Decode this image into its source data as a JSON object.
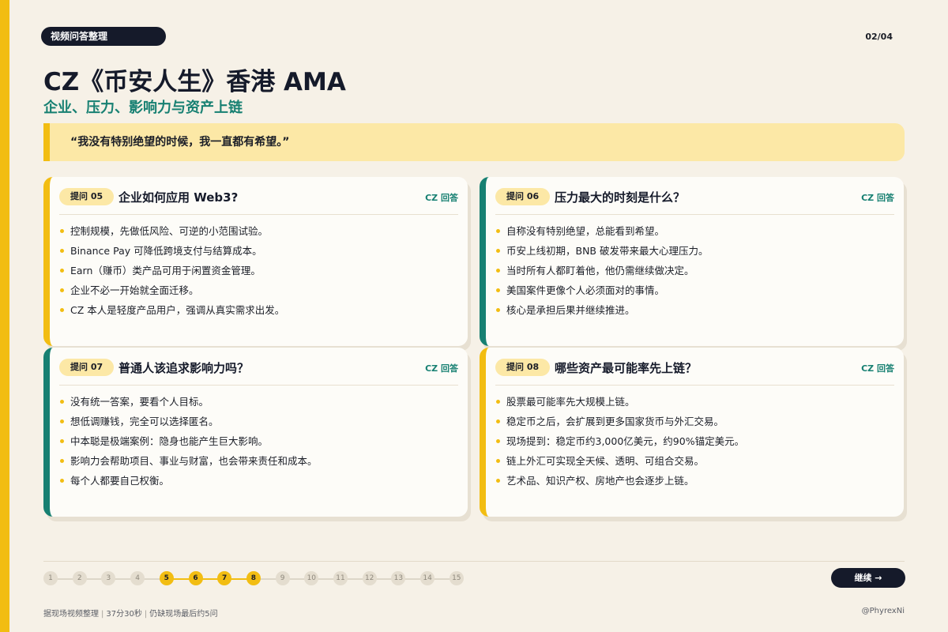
{
  "header": {
    "tag": "视频问答整理",
    "page": "02/04",
    "title": "CZ《币安人生》香港 AMA",
    "subtitle": "企业、压力、影响力与资产上链"
  },
  "quote": "“我没有特别绝望的时候，我一直都有希望。”",
  "cards": [
    {
      "tag": "提问 05",
      "title": "企业如何应用 Web3?",
      "answer_by": "CZ 回答",
      "bullets": [
        "控制规模，先做低风险、可逆的小范围试验。",
        "Binance Pay 可降低跨境支付与结算成本。",
        "Earn（赚币）类产品可用于闲置资金管理。",
        "企业不必一开始就全面迁移。",
        "CZ 本人是轻度产品用户，强调从真实需求出发。"
      ]
    },
    {
      "tag": "提问 06",
      "title": "压力最大的时刻是什么？",
      "answer_by": "CZ 回答",
      "bullets": [
        "自称没有特别绝望，总能看到希望。",
        "币安上线初期，BNB 破发带来最大心理压力。",
        "当时所有人都盯着他，他仍需继续做决定。",
        "美国案件更像个人必须面对的事情。",
        "核心是承担后果并继续推进。"
      ]
    },
    {
      "tag": "提问 07",
      "title": "普通人该追求影响力吗？",
      "answer_by": "CZ 回答",
      "bullets": [
        "没有统一答案，要看个人目标。",
        "想低调赚钱，完全可以选择匿名。",
        "中本聪是极端案例：隐身也能产生巨大影响。",
        "影响力会帮助项目、事业与财富，也会带来责任和成本。",
        "每个人都要自己权衡。"
      ]
    },
    {
      "tag": "提问 08",
      "title": "哪些资产最可能率先上链？",
      "answer_by": "CZ 回答",
      "bullets": [
        "股票最可能率先大规模上链。",
        "稳定币之后，会扩展到更多国家货币与外汇交易。",
        "现场提到：稳定币约3,000亿美元，约90%锚定美元。",
        "链上外汇可实现全天候、透明、可组合交易。",
        "艺术品、知识产权、房地产也会逐步上链。"
      ]
    }
  ],
  "progress": {
    "steps": [
      "1",
      "2",
      "3",
      "4",
      "5",
      "6",
      "7",
      "8",
      "9",
      "10",
      "11",
      "12",
      "13",
      "14",
      "15"
    ],
    "active": [
      "5",
      "6",
      "7",
      "8"
    ]
  },
  "continue_label": "继续 →",
  "footer": {
    "source": "据现场视频整理",
    "duration": "37分30秒",
    "note": "仍缺现场最后约5问",
    "author": "@PhyrexNi"
  },
  "colors": {
    "accent": "#f2bd12",
    "teal": "#178072",
    "dark": "#151a2a",
    "background": "#f6f1e7"
  }
}
